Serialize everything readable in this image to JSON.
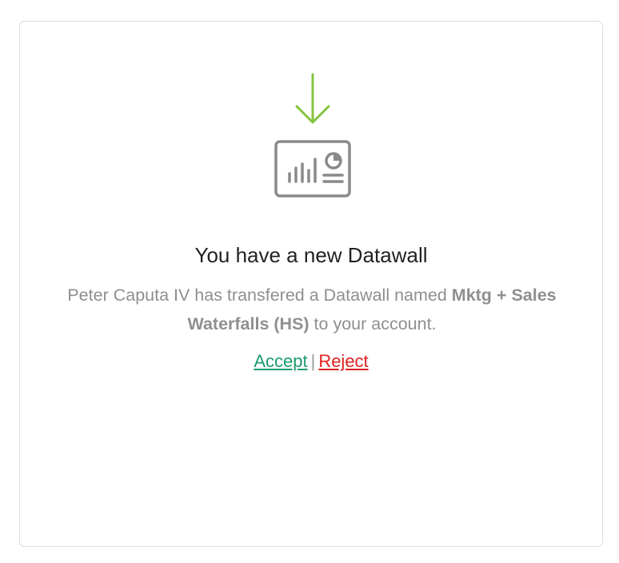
{
  "notification": {
    "title": "You have a new Datawall",
    "message_prefix": "Peter Caputa IV has transfered a Datawall named ",
    "datawall_name": "Mktg + Sales Waterfalls (HS)",
    "message_suffix": " to your account.",
    "icon": "download-dashboard-icon"
  },
  "actions": {
    "accept_label": "Accept",
    "separator": "|",
    "reject_label": "Reject"
  },
  "colors": {
    "arrow": "#86c440",
    "icon_gray": "#8a8a8a",
    "accept": "#1a9d6b",
    "reject": "#e02020"
  }
}
